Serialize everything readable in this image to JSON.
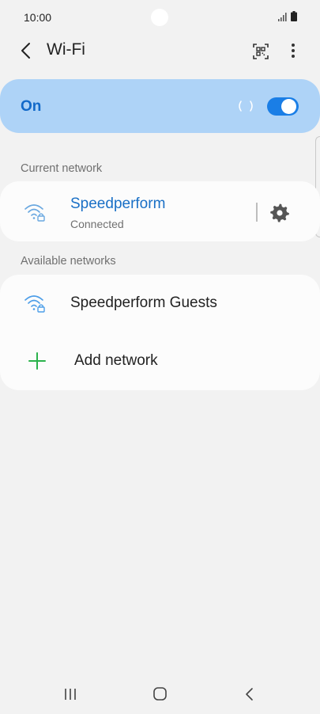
{
  "status_bar": {
    "time": "10:00"
  },
  "header": {
    "title": "Wi-Fi"
  },
  "toggle": {
    "label": "On",
    "enabled": true
  },
  "sections": {
    "current": "Current network",
    "available": "Available networks"
  },
  "current_network": {
    "name": "Speedperform",
    "status": "Connected"
  },
  "available_networks": [
    {
      "name": "Speedperform Guests"
    }
  ],
  "add_network": {
    "label": "Add network"
  },
  "colors": {
    "accent": "#1a7ee6",
    "toggle_bar": "#aed3f7",
    "add_icon": "#2bb24c"
  },
  "icons": [
    "back-icon",
    "qr-code-icon",
    "more-options-icon",
    "wifi-locked-icon",
    "gear-icon",
    "plus-icon",
    "recents-icon",
    "home-icon",
    "nav-back-icon"
  ]
}
